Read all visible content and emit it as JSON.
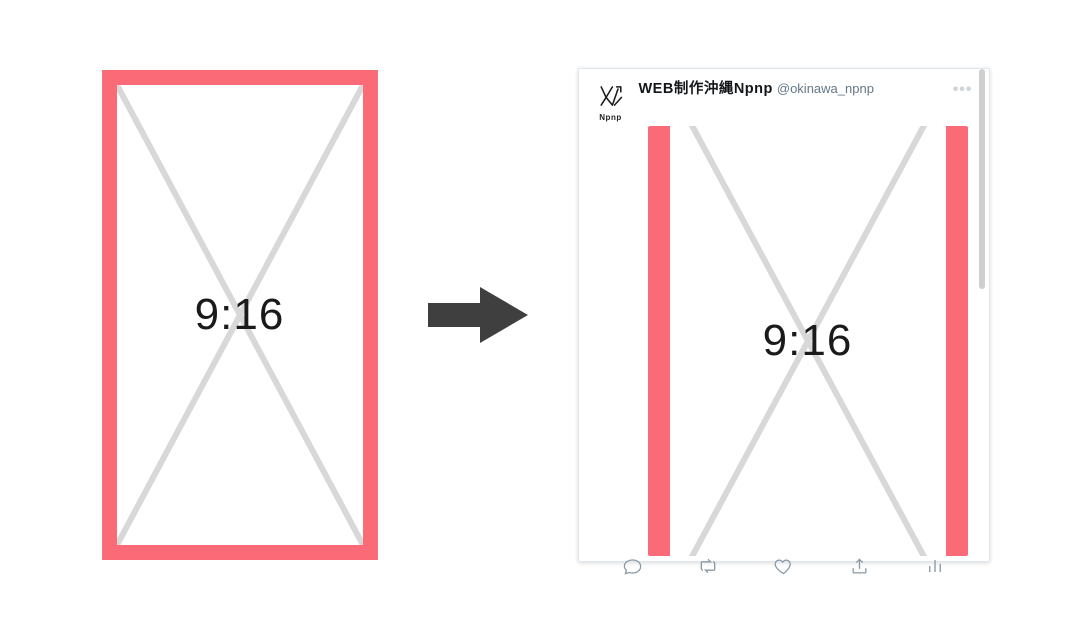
{
  "aspect_ratio_label": "9:16",
  "arrow_color": "#3f3f3f",
  "border_color": "#fa6b77",
  "x_line_color": "#d8d8d8",
  "tweet": {
    "display_name": "WEB制作沖縄Npnp",
    "handle": "@okinawa_npnp",
    "avatar_label": "Npnp"
  },
  "actions": {
    "reply": "reply",
    "retweet": "retweet",
    "like": "like",
    "share": "share",
    "analytics": "analytics"
  }
}
